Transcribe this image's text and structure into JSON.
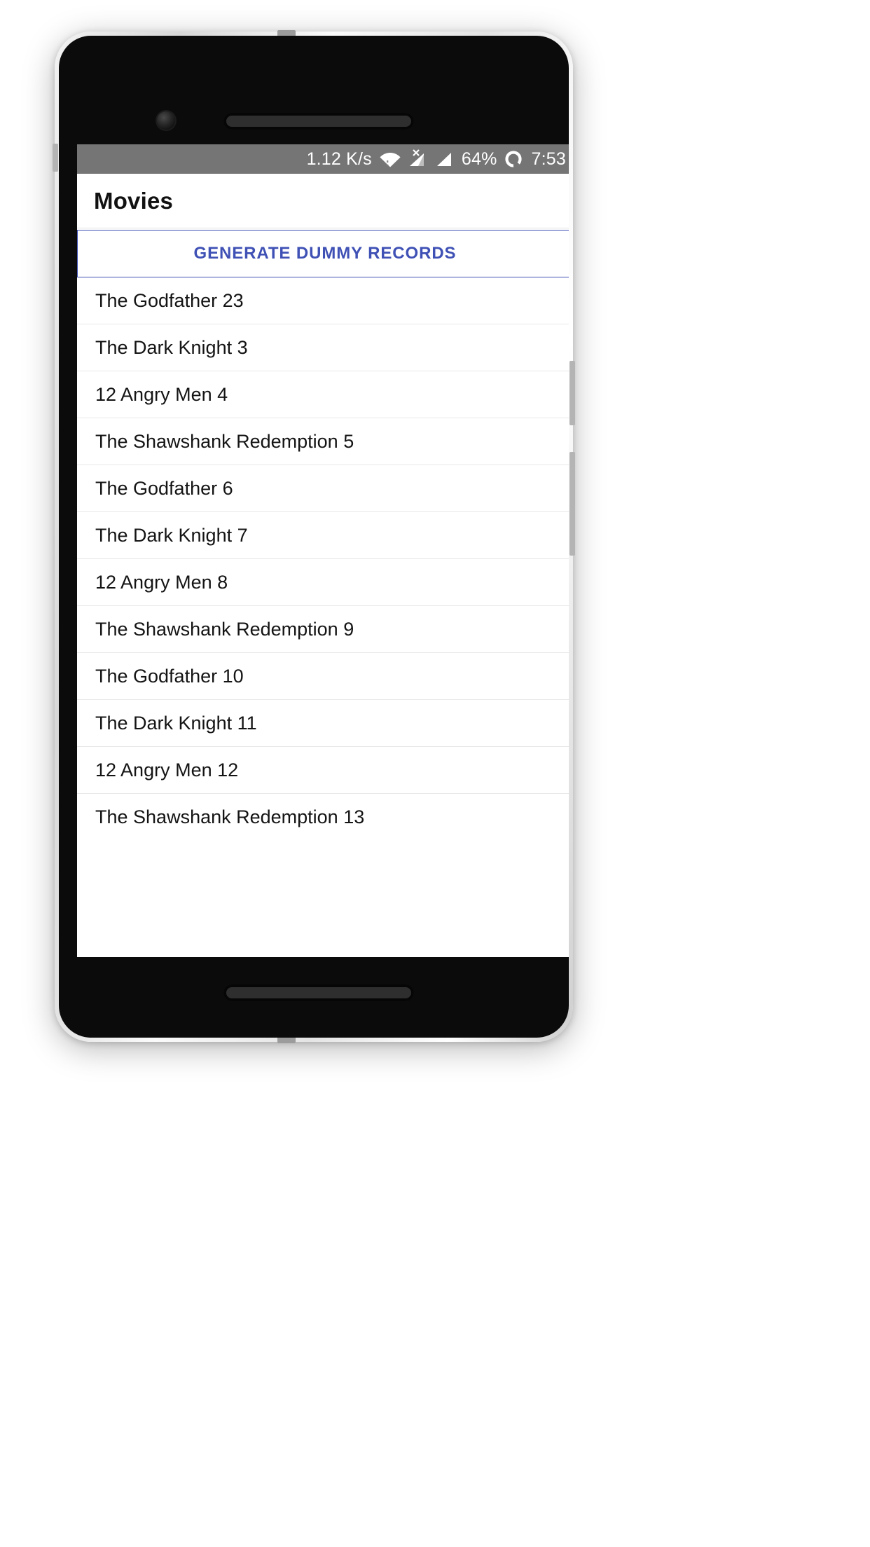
{
  "statusbar": {
    "network_speed": "1.12 K/s",
    "wifi_icon": "wifi-icon",
    "cellular_1_icon": "cellular-no-service-icon",
    "cellular_2_icon": "cellular-signal-icon",
    "battery_percent": "64%",
    "battery_icon": "battery-circle-icon",
    "clock": "7:53",
    "background": "#757575",
    "foreground": "#ffffff"
  },
  "appbar": {
    "title": "Movies",
    "background": "#ffffff",
    "title_color": "#111111"
  },
  "generate_button": {
    "label": "GENERATE DUMMY RECORDS",
    "text_color": "#3f51b5",
    "border_color": "#3f51b5",
    "background": "#ffffff"
  },
  "movie_list": {
    "divider_color": "#e8e8e8",
    "text_color": "#141414",
    "items": [
      {
        "title": "The Godfather 23"
      },
      {
        "title": "The Dark Knight 3"
      },
      {
        "title": "12 Angry Men 4"
      },
      {
        "title": "The Shawshank Redemption 5"
      },
      {
        "title": "The Godfather 6"
      },
      {
        "title": "The Dark Knight 7"
      },
      {
        "title": "12 Angry Men 8"
      },
      {
        "title": "The Shawshank Redemption 9"
      },
      {
        "title": "The Godfather 10"
      },
      {
        "title": "The Dark Knight 11"
      },
      {
        "title": "12 Angry Men 12"
      },
      {
        "title": "The Shawshank Redemption 13"
      }
    ]
  },
  "device": {
    "front_camera_icon": "front-camera-icon",
    "earpiece_icon": "earpiece-speaker-icon",
    "bottom_speaker_icon": "bottom-speaker-icon",
    "power_button_name": "power-button",
    "volume_button_name": "volume-button"
  }
}
